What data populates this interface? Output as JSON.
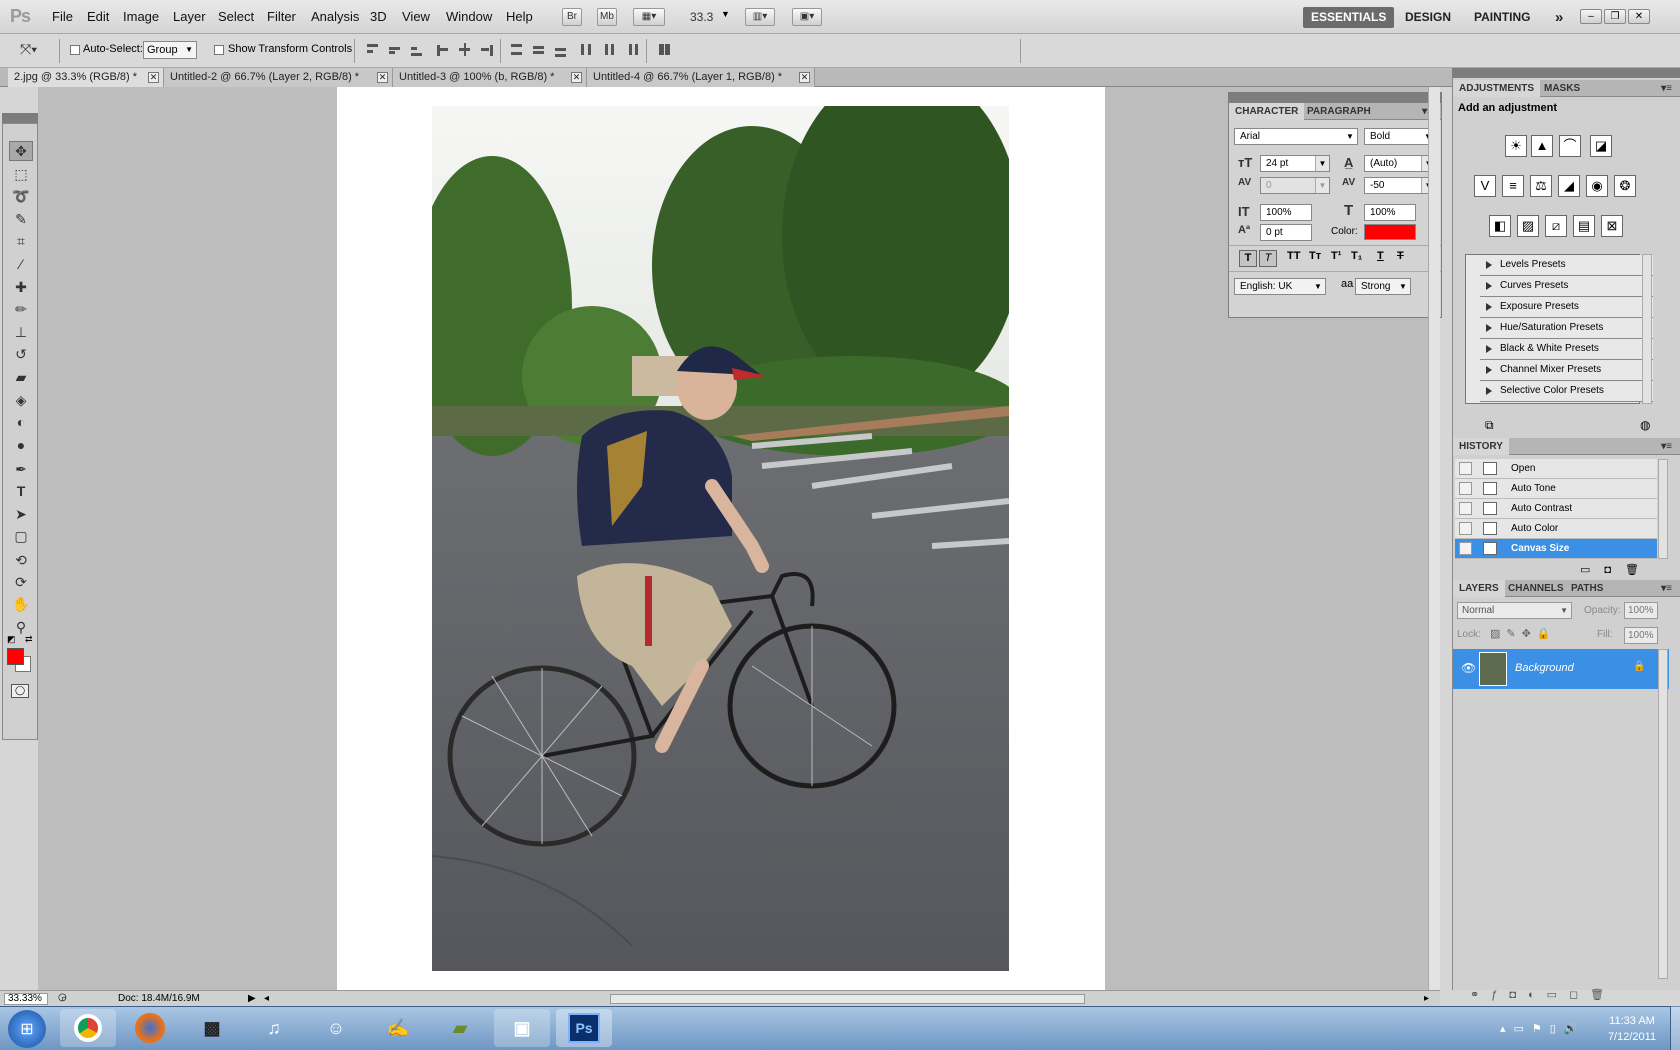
{
  "app": {
    "logo": "Ps"
  },
  "menubar": {
    "items": [
      "File",
      "Edit",
      "Image",
      "Layer",
      "Select",
      "Filter",
      "Analysis",
      "3D",
      "View",
      "Window",
      "Help"
    ],
    "bridge": "Br",
    "minibridge": "Mb",
    "zoom": "33.3",
    "workspaces": [
      "ESSENTIALS",
      "DESIGN",
      "PAINTING"
    ],
    "more": "»"
  },
  "options": {
    "auto_select_label": "Auto-Select:",
    "auto_select_value": "Group",
    "show_transform_label": "Show Transform Controls"
  },
  "doc_tabs": [
    {
      "label": "2.jpg @ 33.3% (RGB/8) *",
      "active": true
    },
    {
      "label": "Untitled-2 @ 66.7% (Layer 2, RGB/8) *",
      "active": false
    },
    {
      "label": "Untitled-3 @ 100% (b, RGB/8) *",
      "active": false
    },
    {
      "label": "Untitled-4 @ 66.7% (Layer 1, RGB/8) *",
      "active": false
    }
  ],
  "character": {
    "tabs": [
      "CHARACTER",
      "PARAGRAPH"
    ],
    "font_family": "Arial",
    "font_style": "Bold",
    "size": "24 pt",
    "leading": "(Auto)",
    "kerning": "0",
    "tracking": "-50",
    "vscale": "100%",
    "hscale": "100%",
    "baseline": "0 pt",
    "color_label": "Color:",
    "color": "#ff0000",
    "language": "English: UK",
    "antialias_icon": "aa",
    "antialias": "Strong"
  },
  "adjustments": {
    "tabs": [
      "ADJUSTMENTS",
      "MASKS"
    ],
    "heading": "Add an adjustment",
    "presets": [
      "Levels Presets",
      "Curves Presets",
      "Exposure Presets",
      "Hue/Saturation Presets",
      "Black & White Presets",
      "Channel Mixer Presets",
      "Selective Color Presets"
    ]
  },
  "history": {
    "tab": "HISTORY",
    "items": [
      "Open",
      "Auto Tone",
      "Auto Contrast",
      "Auto Color",
      "Canvas Size"
    ],
    "selected": "Canvas Size"
  },
  "layers": {
    "tabs": [
      "LAYERS",
      "CHANNELS",
      "PATHS"
    ],
    "blend_mode": "Normal",
    "opacity_label": "Opacity:",
    "opacity": "100%",
    "lock_label": "Lock:",
    "fill_label": "Fill:",
    "fill": "100%",
    "layer_name": "Background"
  },
  "status": {
    "zoom": "33.33%",
    "doc": "Doc: 18.4M/16.9M"
  },
  "taskbar": {
    "time": "11:33 AM",
    "date": "7/12/2011"
  },
  "colors": {
    "foreground": "#ff0000",
    "background": "#ffffff",
    "selection": "#3b8fe5"
  }
}
